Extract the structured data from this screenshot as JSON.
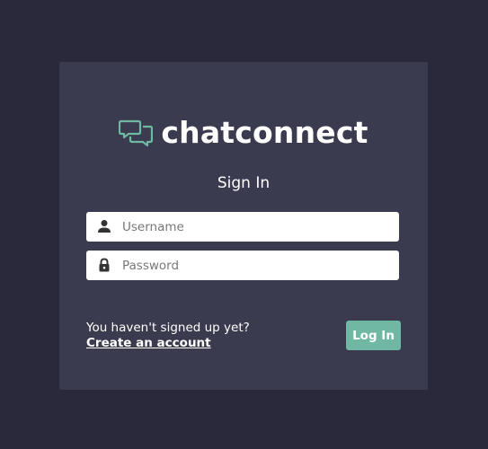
{
  "brand": {
    "name": "chatconnect",
    "icon": "chat-bubbles-icon",
    "accent_color": "#70b8a4"
  },
  "form": {
    "heading": "Sign In",
    "username": {
      "placeholder": "Username",
      "value": "",
      "icon": "user-icon"
    },
    "password": {
      "placeholder": "Password",
      "value": "",
      "icon": "lock-icon"
    },
    "submit_label": "Log In"
  },
  "signup": {
    "prompt": "You haven't signed up yet?",
    "link_label": "Create an account"
  },
  "colors": {
    "background": "#29293b",
    "card": "#3b3b50",
    "button": "#70b8a4"
  }
}
